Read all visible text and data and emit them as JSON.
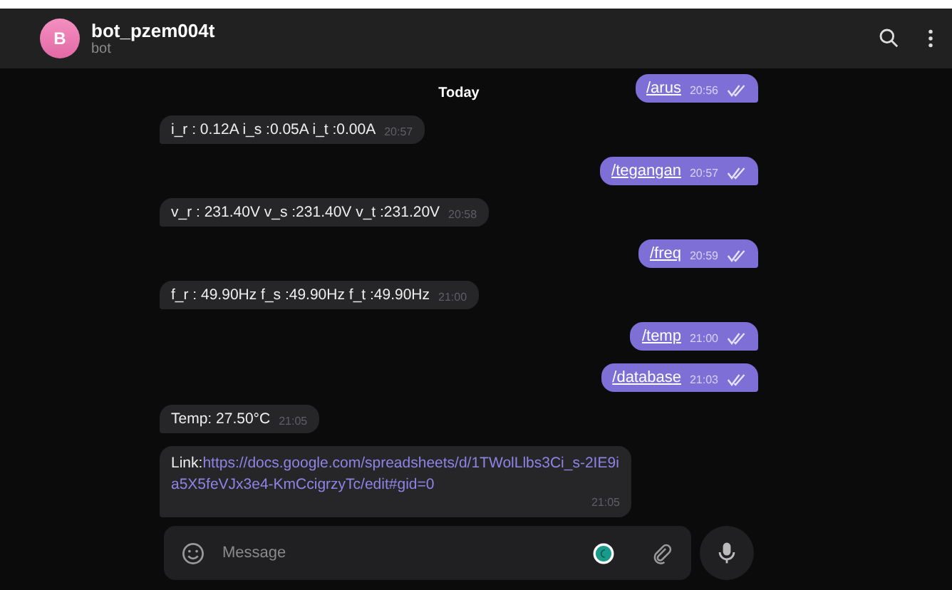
{
  "header": {
    "avatar_letter": "B",
    "title": "bot_pzem004t",
    "subtitle": "bot"
  },
  "date_label": "Today",
  "messages": [
    {
      "kind": "out",
      "text": "/arus",
      "time": "20:56",
      "read": true
    },
    {
      "kind": "in",
      "text": "i_r : 0.12A i_s :0.05A i_t :0.00A",
      "time": "20:57"
    },
    {
      "kind": "out",
      "text": "/tegangan",
      "time": "20:57",
      "read": true
    },
    {
      "kind": "in",
      "text": "v_r : 231.40V v_s :231.40V v_t :231.20V",
      "time": "20:58"
    },
    {
      "kind": "out",
      "text": "/freq",
      "time": "20:59",
      "read": true
    },
    {
      "kind": "in",
      "text": "f_r : 49.90Hz f_s :49.90Hz f_t :49.90Hz",
      "time": "21:00"
    },
    {
      "kind": "out",
      "text": "/temp",
      "time": "21:00",
      "read": true
    },
    {
      "kind": "out",
      "text": "/database",
      "time": "21:03",
      "read": true
    },
    {
      "kind": "in",
      "text": "Temp: 27.50°C",
      "time": "21:05"
    },
    {
      "kind": "link",
      "text": "Link:",
      "url": "https://docs.google.com/spreadsheets/d/1TWolLlbs3Ci_s-2IE9ia5X5feVJx3e4-KmCcigrzyTc/edit#gid=0",
      "time": "21:05"
    }
  ],
  "composer": {
    "placeholder": "Message"
  }
}
